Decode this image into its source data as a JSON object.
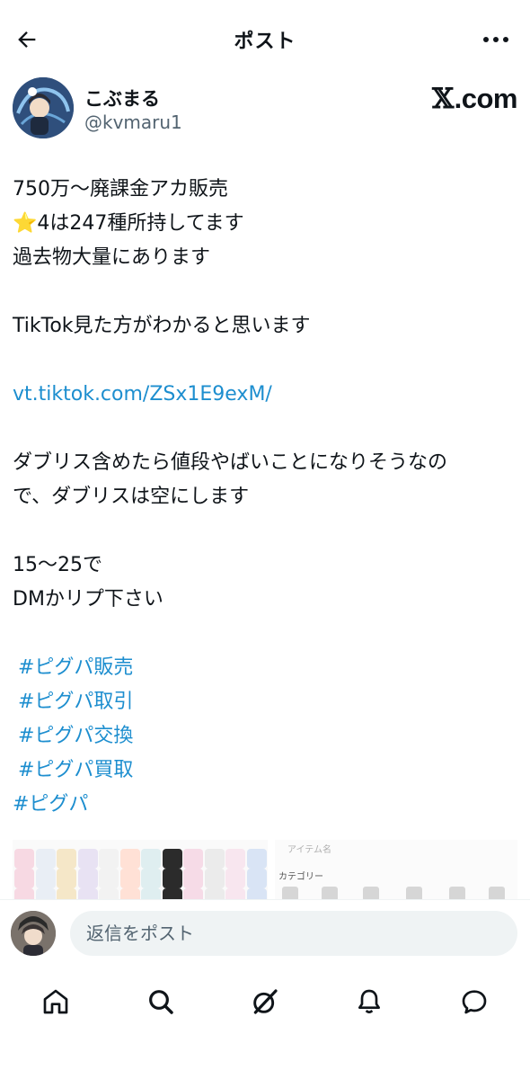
{
  "header": {
    "title": "ポスト"
  },
  "author": {
    "name": "こぶまる",
    "handle": "@kvmaru1"
  },
  "source": {
    "x": "𝕏",
    "domain": ".com"
  },
  "post": {
    "line1": "750万〜廃課金アカ販売",
    "line2_star": "⭐",
    "line2": "4は247種所持してます",
    "line3": "過去物大量にあります",
    "line4": "TikTok見た方がわかると思います",
    "link": "vt.tiktok.com/ZSx1E9exM/",
    "line5": "ダブリス含めたら値段やばいことになりそうなの",
    "line6": "で、ダブリスは空にします",
    "line7": "15〜25で",
    "line8": "DMかリプ下さい",
    "tags": [
      "#ピグパ販売",
      "#ピグパ取引",
      "#ピグパ交換",
      "#ピグパ買取",
      "#ピグパ"
    ]
  },
  "media": {
    "search_placeholder": "アイテム名",
    "category_label": "カテゴリー"
  },
  "reply": {
    "placeholder": "返信をポスト"
  },
  "tabs": [
    "home-icon",
    "search-icon",
    "grok-icon",
    "notifications-icon",
    "messages-icon"
  ],
  "colors": {
    "link": "#1d8ecf",
    "text": "#0f1419",
    "muted": "#536471",
    "input_bg": "#eff3f4"
  }
}
